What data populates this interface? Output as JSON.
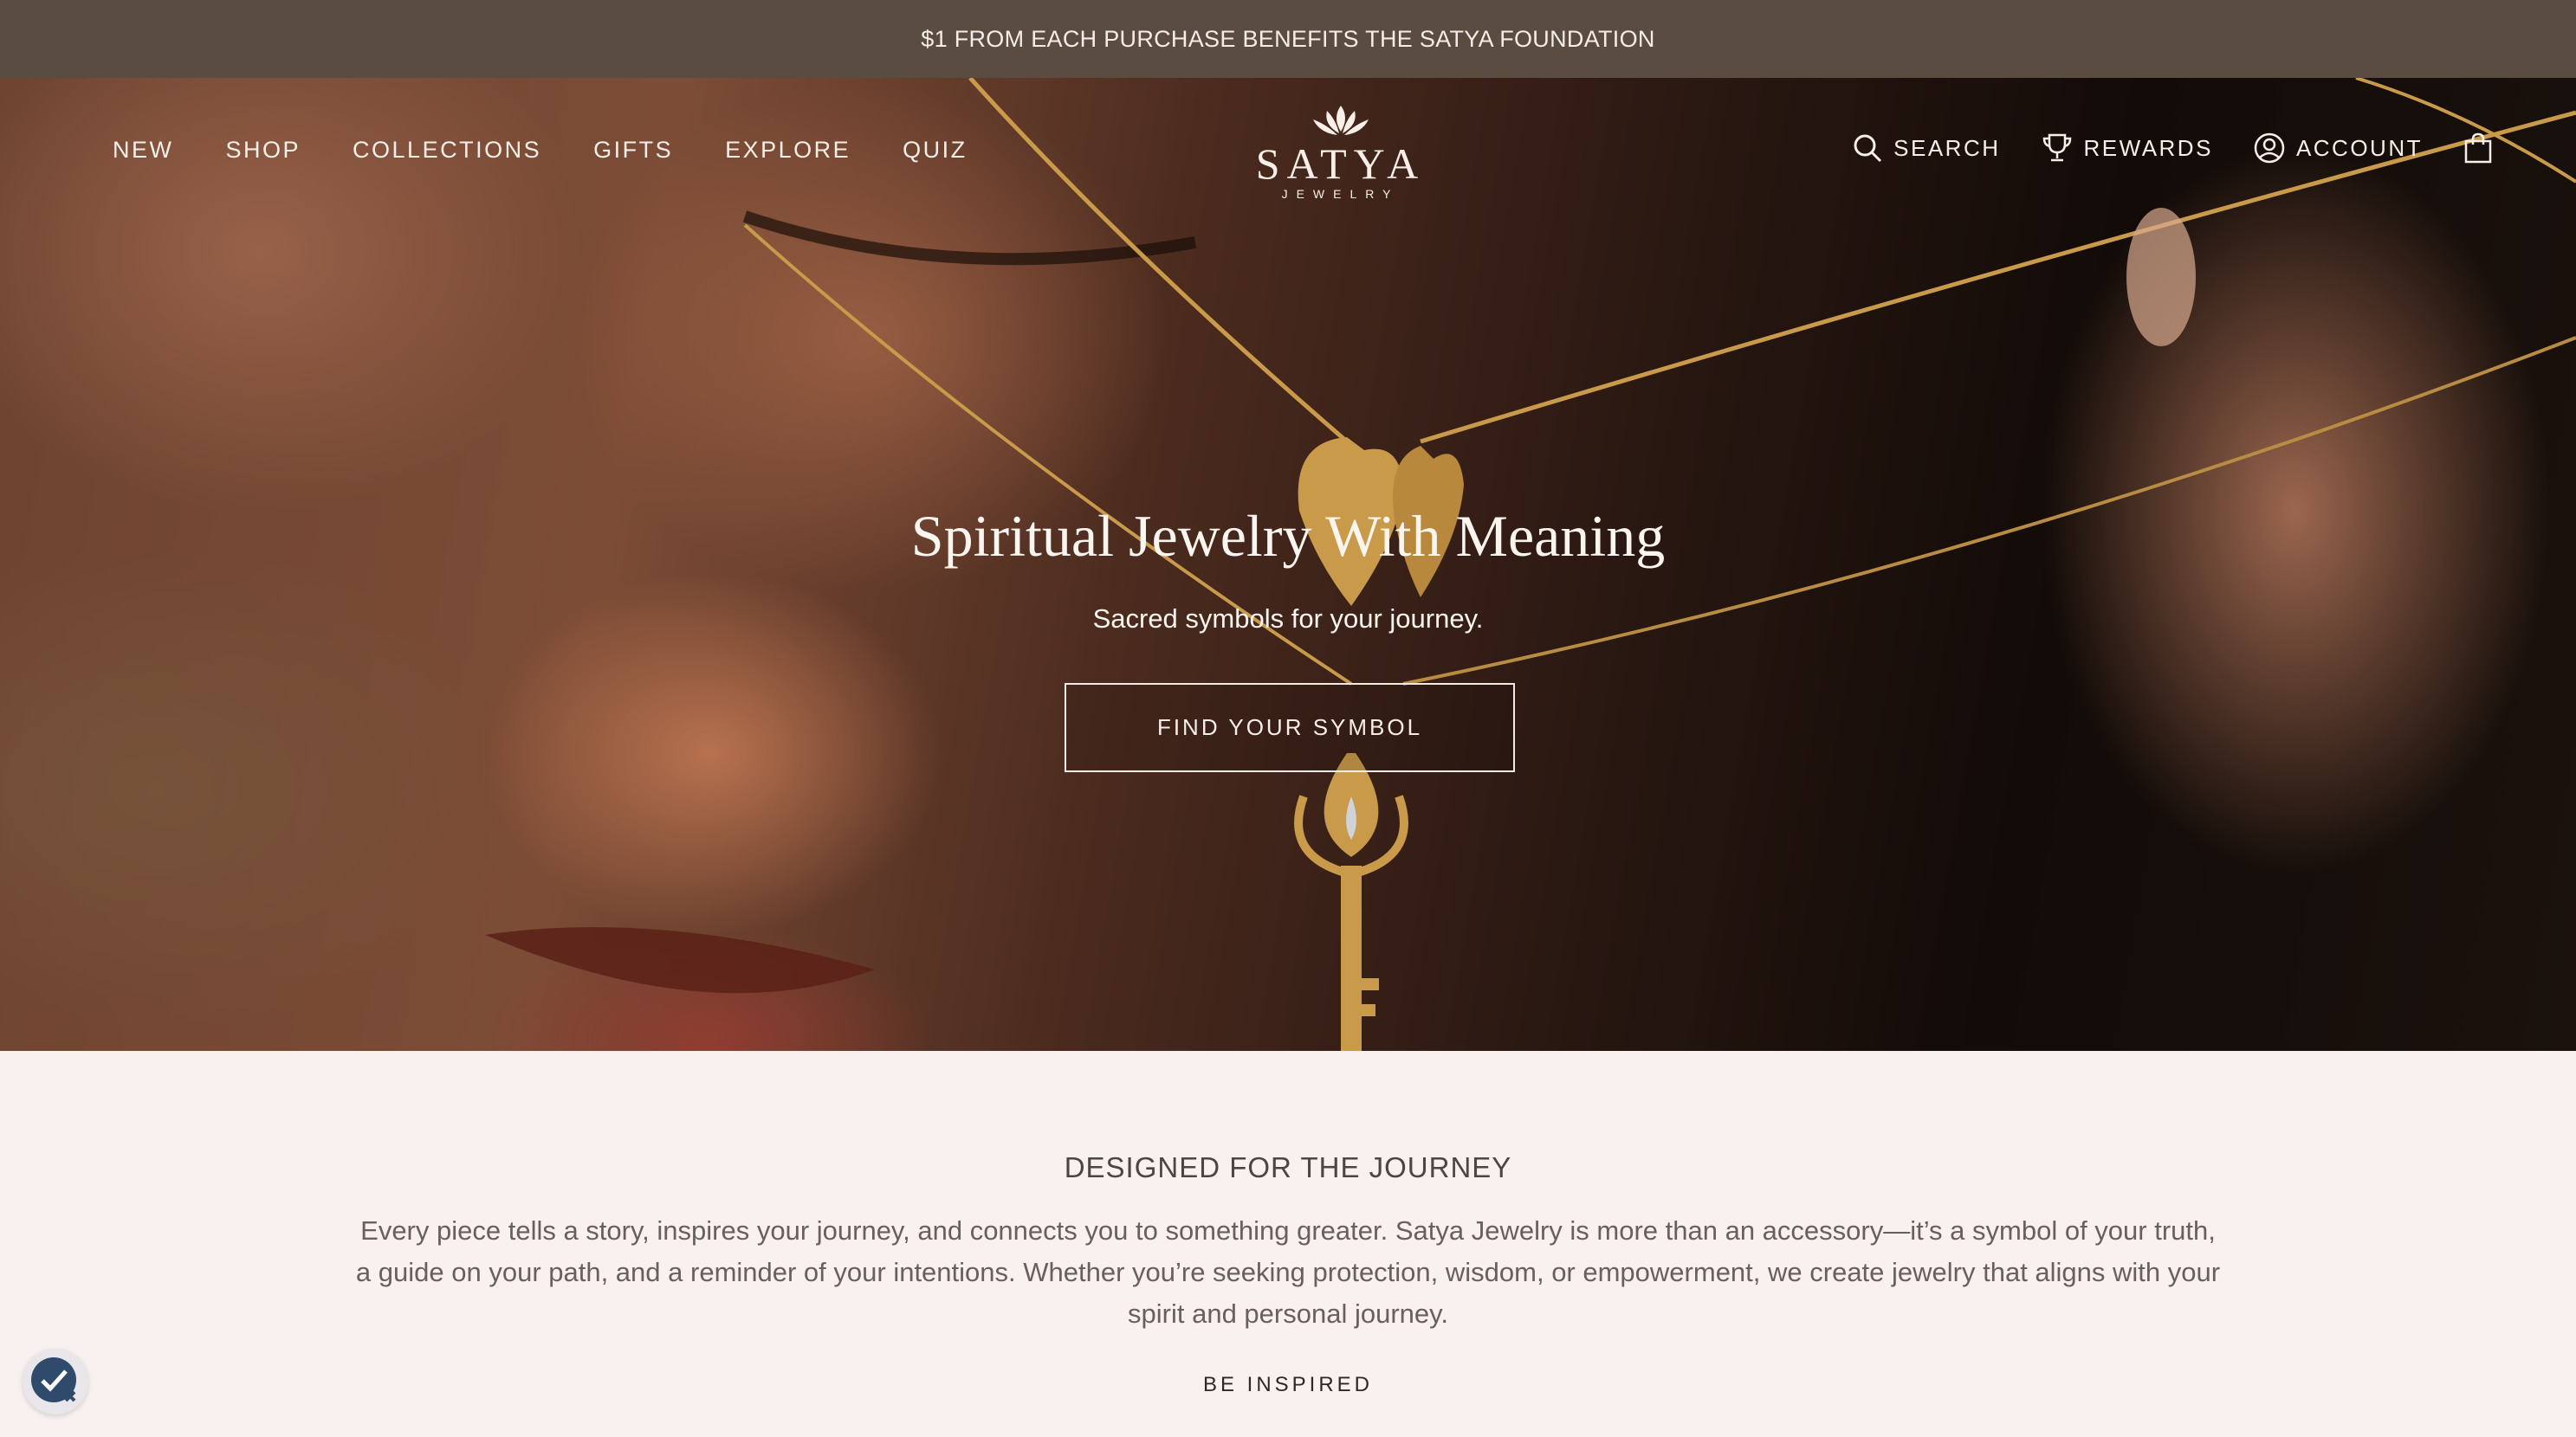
{
  "announcement": {
    "text": "$1 FROM EACH PURCHASE BENEFITS THE SATYA FOUNDATION"
  },
  "nav": {
    "left_items": [
      {
        "label": "NEW"
      },
      {
        "label": "SHOP"
      },
      {
        "label": "COLLECTIONS"
      },
      {
        "label": "GIFTS"
      },
      {
        "label": "EXPLORE"
      },
      {
        "label": "QUIZ"
      }
    ],
    "logo": {
      "brand": "SATYA",
      "sub": "JEWELRY",
      "icon": "lotus-icon"
    },
    "right_items": {
      "search": {
        "label": "SEARCH",
        "icon": "search-icon"
      },
      "rewards": {
        "label": "REWARDS",
        "icon": "trophy-icon"
      },
      "account": {
        "label": "ACCOUNT",
        "icon": "user-icon"
      },
      "cart": {
        "icon": "shopping-bag-icon"
      }
    }
  },
  "hero": {
    "title": "Spiritual Jewelry With Meaning",
    "subtitle": "Sacred symbols for your journey.",
    "button_label": "FIND YOUR SYMBOL"
  },
  "intro": {
    "heading": "DESIGNED FOR THE JOURNEY",
    "body": "Every piece tells a story, inspires your journey, and connects you to something greater. Satya Jewelry is more than an accessory—it’s a symbol of your truth, a guide on your path, and a reminder of your intentions. Whether you’re seeking protection, wisdom, or empowerment, we create jewelry that aligns with your spirit and personal journey.",
    "cta_label": "BE INSPIRED"
  },
  "accessibility_badge": {
    "icon": "accessibility-check-icon"
  },
  "colors": {
    "announcement_bg": "#5b4c41",
    "intro_bg": "#f8f1ef",
    "gold": "#c99a4a",
    "badge_navy": "#2f4a6b"
  }
}
